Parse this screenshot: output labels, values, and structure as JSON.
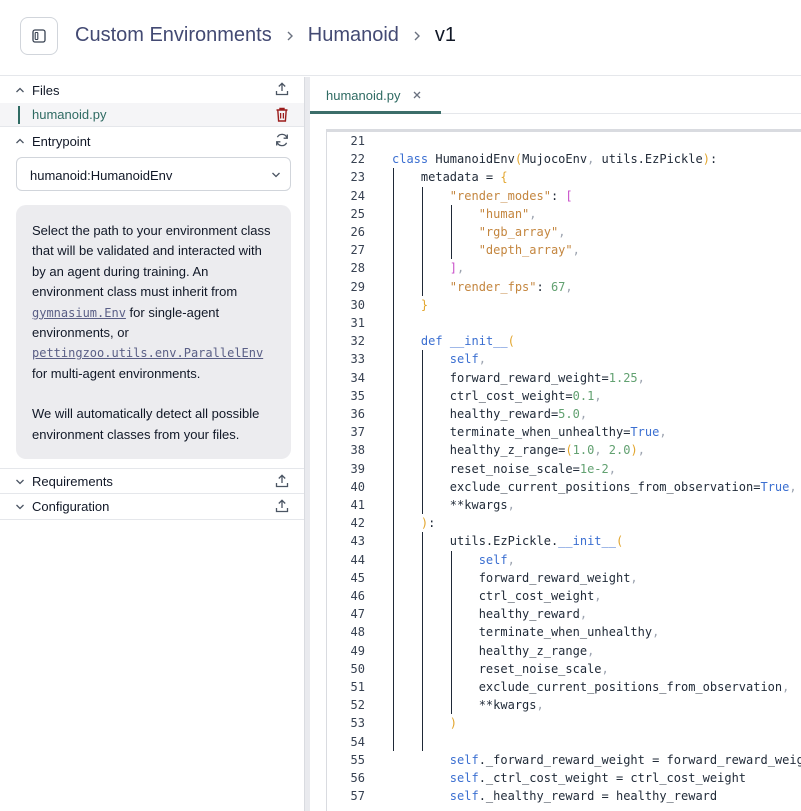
{
  "header": {
    "breadcrumbs": [
      "Custom Environments",
      "Humanoid",
      "v1"
    ]
  },
  "sidebar": {
    "files_label": "Files",
    "file_name": "humanoid.py",
    "entrypoint_label": "Entrypoint",
    "entrypoint_value": "humanoid:HumanoidEnv",
    "info": {
      "p1_a": "Select the path to your environment class that will be validated and interacted with by an agent during training. An environment class must inherit from ",
      "link1": "gymnasium.Env",
      "p1_b": " for single-agent environments, or ",
      "link2": "pettingzoo.utils.env.ParallelEnv",
      "p1_c": " for multi-agent environments.",
      "p2": "We will automatically detect all possible environment classes from your files."
    },
    "requirements_label": "Requirements",
    "configuration_label": "Configuration"
  },
  "editor": {
    "tab_label": "humanoid.py",
    "lines": [
      {
        "n": "21",
        "code": ""
      },
      {
        "n": "22",
        "code": "class HumanoidEnv(MujocoEnv, utils.EzPickle):"
      },
      {
        "n": "23",
        "code": "    metadata = {"
      },
      {
        "n": "24",
        "code": "        \"render_modes\": ["
      },
      {
        "n": "25",
        "code": "            \"human\","
      },
      {
        "n": "26",
        "code": "            \"rgb_array\","
      },
      {
        "n": "27",
        "code": "            \"depth_array\","
      },
      {
        "n": "28",
        "code": "        ],"
      },
      {
        "n": "29",
        "code": "        \"render_fps\": 67,"
      },
      {
        "n": "30",
        "code": "    }"
      },
      {
        "n": "31",
        "code": ""
      },
      {
        "n": "32",
        "code": "    def __init__("
      },
      {
        "n": "33",
        "code": "        self,"
      },
      {
        "n": "34",
        "code": "        forward_reward_weight=1.25,"
      },
      {
        "n": "35",
        "code": "        ctrl_cost_weight=0.1,"
      },
      {
        "n": "36",
        "code": "        healthy_reward=5.0,"
      },
      {
        "n": "37",
        "code": "        terminate_when_unhealthy=True,"
      },
      {
        "n": "38",
        "code": "        healthy_z_range=(1.0, 2.0),"
      },
      {
        "n": "39",
        "code": "        reset_noise_scale=1e-2,"
      },
      {
        "n": "40",
        "code": "        exclude_current_positions_from_observation=True,"
      },
      {
        "n": "41",
        "code": "        **kwargs,"
      },
      {
        "n": "42",
        "code": "    ):"
      },
      {
        "n": "43",
        "code": "        utils.EzPickle.__init__("
      },
      {
        "n": "44",
        "code": "            self,"
      },
      {
        "n": "45",
        "code": "            forward_reward_weight,"
      },
      {
        "n": "46",
        "code": "            ctrl_cost_weight,"
      },
      {
        "n": "47",
        "code": "            healthy_reward,"
      },
      {
        "n": "48",
        "code": "            terminate_when_unhealthy,"
      },
      {
        "n": "49",
        "code": "            healthy_z_range,"
      },
      {
        "n": "50",
        "code": "            reset_noise_scale,"
      },
      {
        "n": "51",
        "code": "            exclude_current_positions_from_observation,"
      },
      {
        "n": "52",
        "code": "            **kwargs,"
      },
      {
        "n": "53",
        "code": "        )"
      },
      {
        "n": "54",
        "code": ""
      },
      {
        "n": "55",
        "code": "        self._forward_reward_weight = forward_reward_weight"
      },
      {
        "n": "56",
        "code": "        self._ctrl_cost_weight = ctrl_cost_weight"
      },
      {
        "n": "57",
        "code": "        self._healthy_reward = healthy_reward"
      }
    ]
  },
  "colors": {
    "accent": "#2f6b63",
    "breadcrumb": "#434a73",
    "trash": "#9b1c1c"
  },
  "icons": [
    "sidebar-toggle-icon",
    "chevron-right-icon",
    "chevron-up-icon",
    "chevron-down-icon",
    "upload-icon",
    "trash-icon",
    "refresh-icon",
    "close-icon"
  ]
}
